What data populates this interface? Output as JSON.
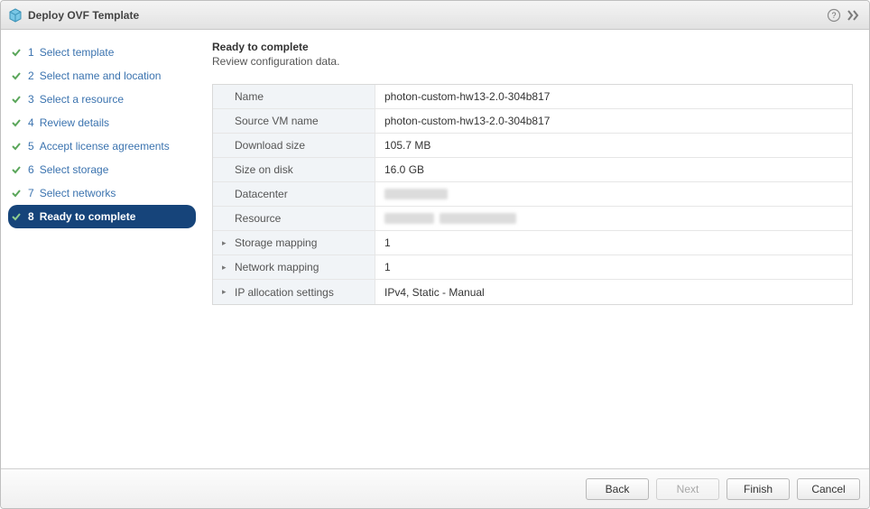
{
  "header": {
    "title": "Deploy OVF Template"
  },
  "sidebar": {
    "steps": [
      {
        "n": "1",
        "label": "Select template"
      },
      {
        "n": "2",
        "label": "Select name and location"
      },
      {
        "n": "3",
        "label": "Select a resource"
      },
      {
        "n": "4",
        "label": "Review details"
      },
      {
        "n": "5",
        "label": "Accept license agreements"
      },
      {
        "n": "6",
        "label": "Select storage"
      },
      {
        "n": "7",
        "label": "Select networks"
      },
      {
        "n": "8",
        "label": "Ready to complete"
      }
    ]
  },
  "main": {
    "title": "Ready to complete",
    "subtitle": "Review configuration data."
  },
  "summary": {
    "name_label": "Name",
    "name_value": "photon-custom-hw13-2.0-304b817",
    "source_label": "Source VM name",
    "source_value": "photon-custom-hw13-2.0-304b817",
    "download_label": "Download size",
    "download_value": "105.7 MB",
    "size_label": "Size on disk",
    "size_value": "16.0 GB",
    "datacenter_label": "Datacenter",
    "resource_label": "Resource",
    "storage_label": "Storage mapping",
    "storage_value": "1",
    "network_label": "Network mapping",
    "network_value": "1",
    "ip_label": "IP allocation settings",
    "ip_value": "IPv4, Static - Manual"
  },
  "footer": {
    "back": "Back",
    "next": "Next",
    "finish": "Finish",
    "cancel": "Cancel"
  }
}
